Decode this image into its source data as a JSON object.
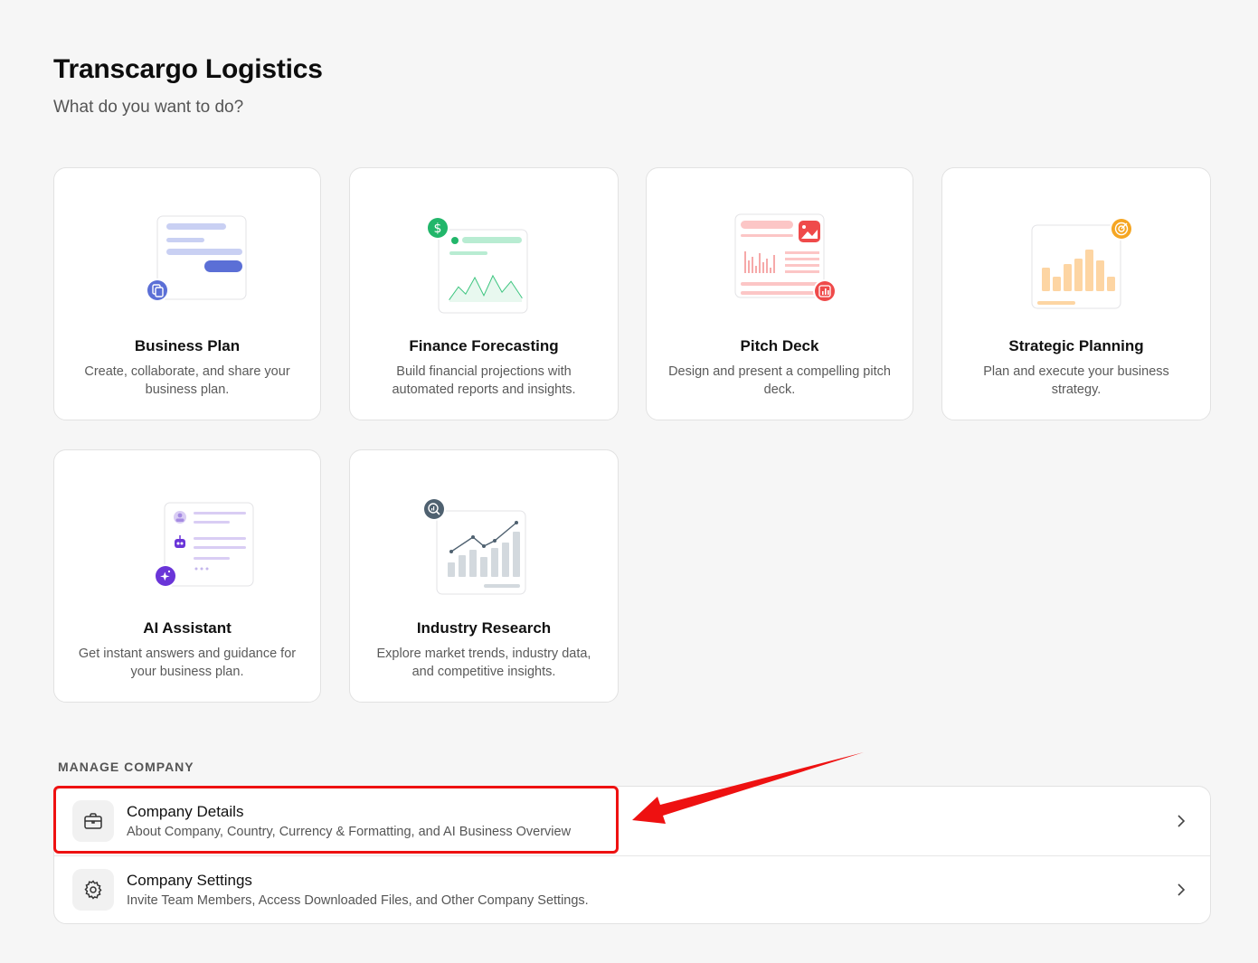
{
  "header": {
    "title": "Transcargo Logistics",
    "subtitle": "What do you want to do?"
  },
  "cards": [
    {
      "title": "Business Plan",
      "desc": "Create, collaborate, and share your business plan.",
      "icon": "document-icon",
      "accent": "#5b6fd6"
    },
    {
      "title": "Finance Forecasting",
      "desc": "Build financial projections with automated reports and insights.",
      "icon": "dollar-icon",
      "accent": "#22b66a"
    },
    {
      "title": "Pitch Deck",
      "desc": "Design and present a compelling pitch deck.",
      "icon": "presentation-icon",
      "accent": "#ef4a4a"
    },
    {
      "title": "Strategic Planning",
      "desc": "Plan and execute your business strategy.",
      "icon": "target-icon",
      "accent": "#f5a623"
    },
    {
      "title": "AI Assistant",
      "desc": "Get instant answers and guidance for your business plan.",
      "icon": "sparkle-icon",
      "accent": "#6a35d8"
    },
    {
      "title": "Industry Research",
      "desc": "Explore market trends, industry data, and competitive insights.",
      "icon": "magnifier-chart-icon",
      "accent": "#4f6170"
    }
  ],
  "manage": {
    "label": "MANAGE COMPANY",
    "items": [
      {
        "title": "Company Details",
        "sub": "About Company, Country, Currency & Formatting, and AI Business Overview",
        "icon": "briefcase-icon"
      },
      {
        "title": "Company Settings",
        "sub": "Invite Team Members, Access Downloaded Files, and Other Company Settings.",
        "icon": "gear-icon"
      }
    ]
  },
  "annotation_color": "#ee1111"
}
